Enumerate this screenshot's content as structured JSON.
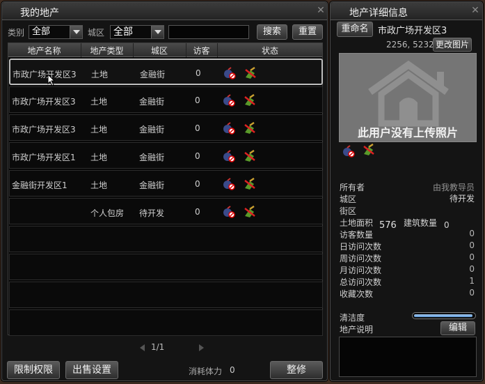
{
  "left_panel": {
    "title": "我的地产",
    "close": "✕",
    "filter": {
      "category_label": "类别",
      "category_value": "全部",
      "district_label": "城区",
      "district_value": "全部",
      "search_value": "",
      "search_button": "搜索",
      "reset_button": "重置"
    },
    "table": {
      "headers": [
        "地产名称",
        "地产类型",
        "城区",
        "访客",
        "状态"
      ],
      "rows": [
        {
          "name": "市政广场开发区3",
          "type": "土地",
          "district": "金融街",
          "visitors": "0"
        },
        {
          "name": "市政广场开发区3",
          "type": "土地",
          "district": "金融街",
          "visitors": "0"
        },
        {
          "name": "市政广场开发区3",
          "type": "土地",
          "district": "金融街",
          "visitors": "0"
        },
        {
          "name": "市政广场开发区1",
          "type": "土地",
          "district": "金融街",
          "visitors": "0"
        },
        {
          "name": "金融街开发区1",
          "type": "土地",
          "district": "金融街",
          "visitors": "0"
        },
        {
          "name": "",
          "type": "个人包房",
          "district": "待开发",
          "visitors": "0"
        }
      ]
    },
    "pager": "1/1",
    "bottom": {
      "limit_button": "限制权限",
      "sale_button": "出售设置",
      "stamina_label": "消耗体力",
      "stamina_value": "0",
      "repair_button": "整修"
    }
  },
  "right_panel": {
    "title": "地产详细信息",
    "close": "✕",
    "rename_button": "重命名",
    "property_name": "市政广场开发区3",
    "coords": "2256, 5232",
    "change_photo_button": "更改图片",
    "no_photo_text": "此用户没有上传照片",
    "owner_label": "所有者",
    "owner_value": "由我教导员",
    "district_label": "城区",
    "district_value": "待开发",
    "street_label": "街区",
    "land_area_label": "土地面积",
    "land_area_value": "576",
    "building_count_label": "建筑数量",
    "building_count_value": "0",
    "stats": [
      {
        "label": "访客数量",
        "value": "0"
      },
      {
        "label": "日访问次数",
        "value": "0"
      },
      {
        "label": "周访问次数",
        "value": "0"
      },
      {
        "label": "月访问次数",
        "value": "0"
      },
      {
        "label": "总访问次数",
        "value": "1"
      },
      {
        "label": "收藏次数",
        "value": "0"
      }
    ],
    "cleanliness_label": "清洁度",
    "cleanliness_level": 0.98,
    "description_label": "地产说明",
    "edit_button": "编辑",
    "description_text": ""
  },
  "colors": {
    "progress": "#5b95d4",
    "panel_bg": "#141414"
  },
  "icons": [
    "no-bomb-icon",
    "no-broom-icon"
  ]
}
